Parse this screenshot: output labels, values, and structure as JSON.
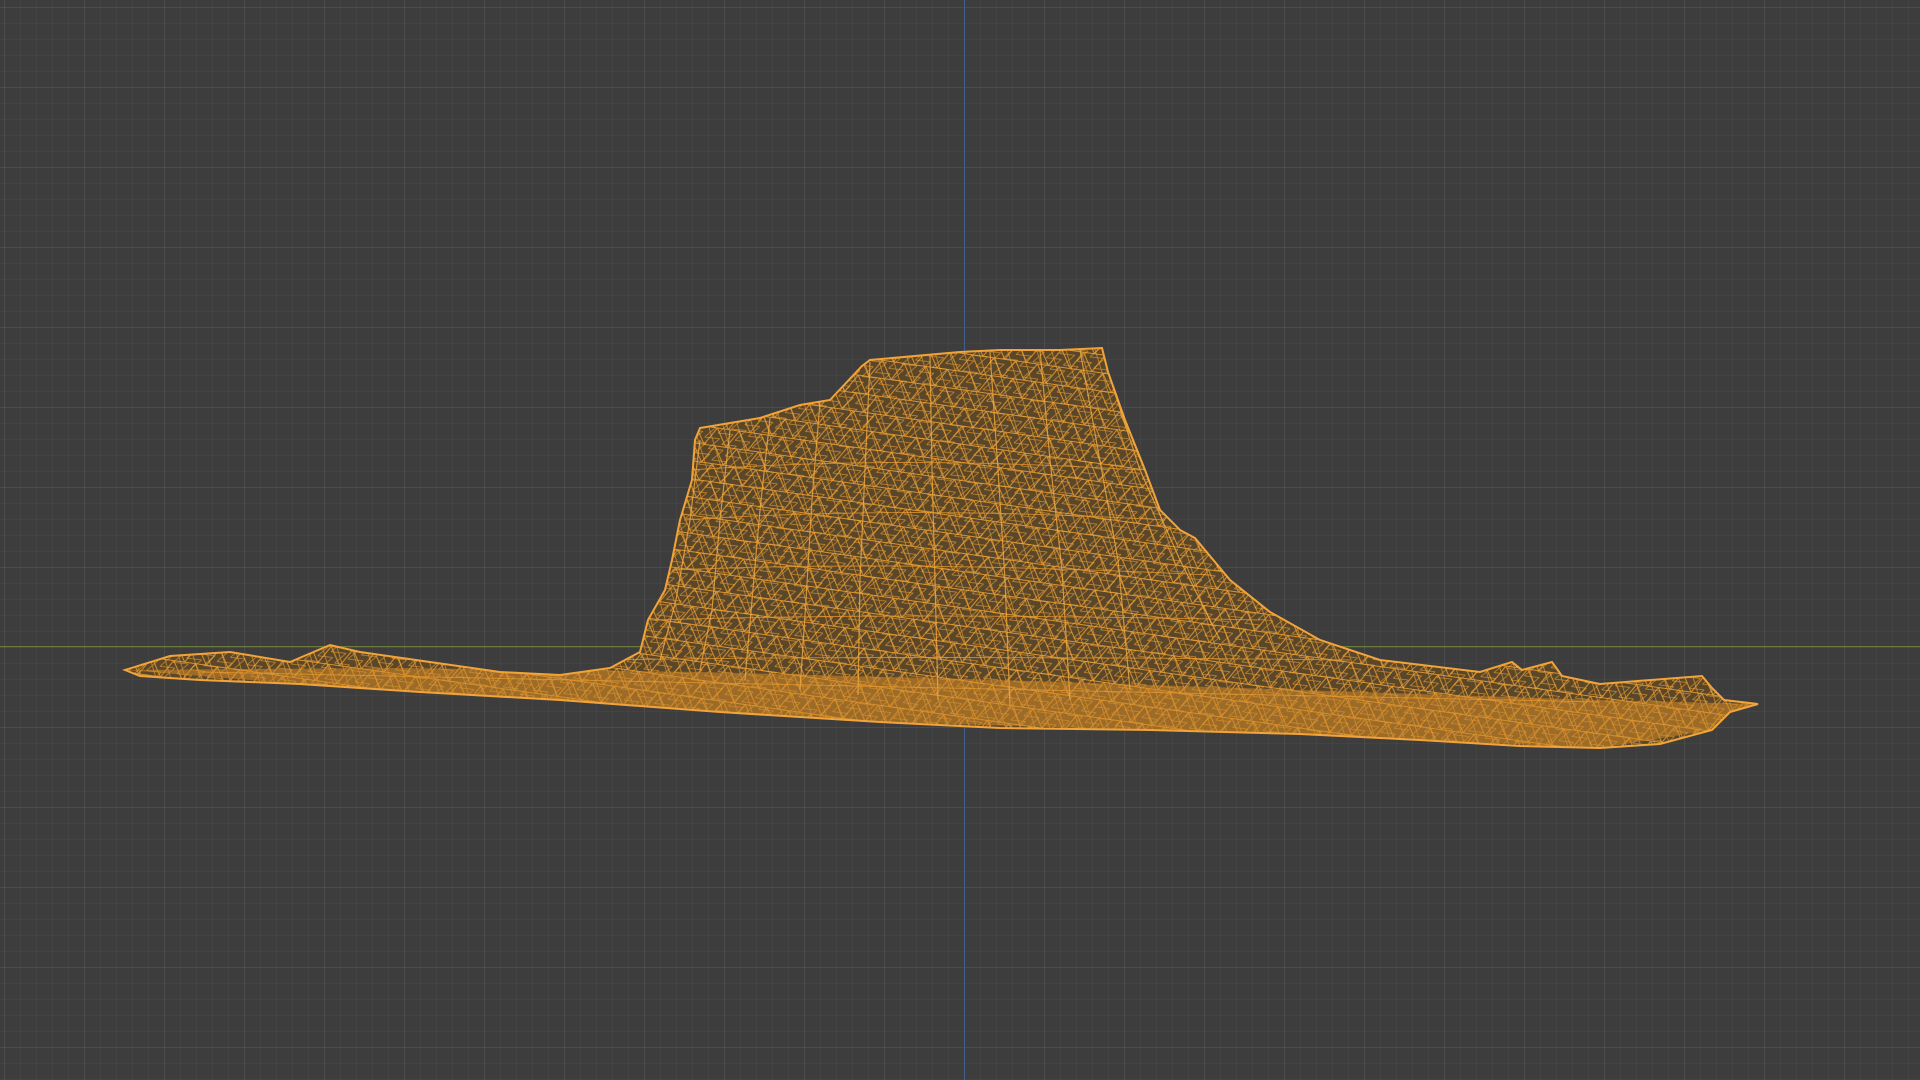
{
  "viewport": {
    "mode": "wireframe",
    "background_color": "#3d3d3d",
    "grid_color": "#4a4a4a",
    "axis_x_color": "#6b7a3c",
    "axis_z_color": "#3f5f8f"
  },
  "object": {
    "kind": "scanned-rock-terrain-mesh",
    "selected": true,
    "wire_color": "#f0a030"
  }
}
